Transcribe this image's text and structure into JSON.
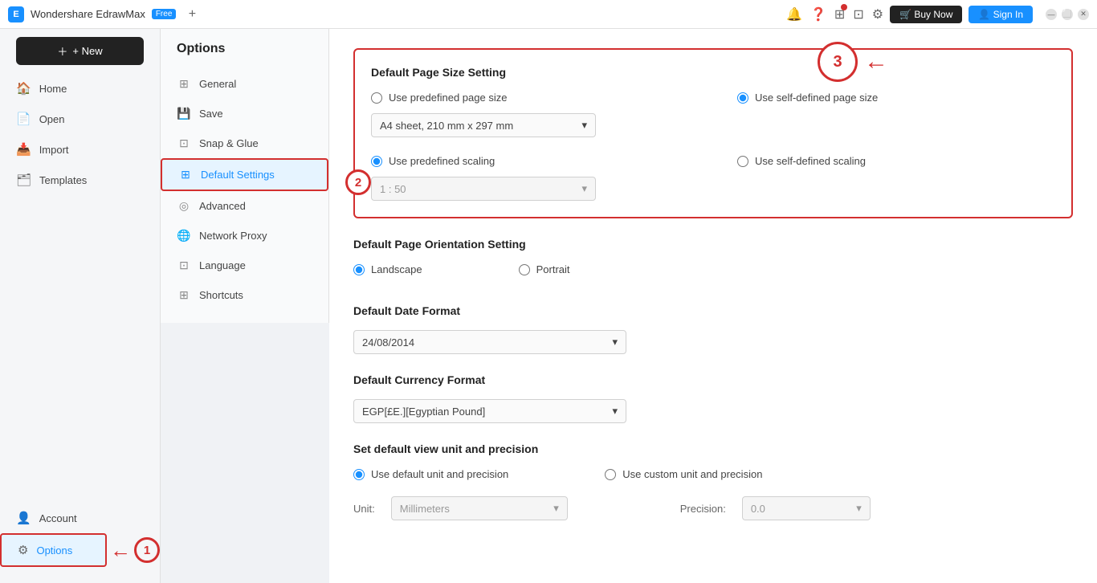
{
  "titleBar": {
    "appName": "Wondershare EdrawMax",
    "freeBadge": "Free",
    "addTab": "+",
    "buyLabel": "🛒 Buy Now",
    "signinLabel": "👤 Sign In"
  },
  "sidebar": {
    "newLabel": "+ New",
    "items": [
      {
        "id": "home",
        "label": "Home",
        "icon": "🏠"
      },
      {
        "id": "open",
        "label": "Open",
        "icon": "📄"
      },
      {
        "id": "import",
        "label": "Import",
        "icon": "📥"
      },
      {
        "id": "templates",
        "label": "Templates",
        "icon": "🗂"
      }
    ],
    "bottomItems": [
      {
        "id": "account",
        "label": "Account",
        "icon": "👤"
      },
      {
        "id": "options",
        "label": "Options",
        "icon": "⚙"
      }
    ]
  },
  "optionsPanel": {
    "title": "Options",
    "items": [
      {
        "id": "general",
        "label": "General",
        "icon": "⊞"
      },
      {
        "id": "save",
        "label": "Save",
        "icon": "💾"
      },
      {
        "id": "snapglue",
        "label": "Snap & Glue",
        "icon": "⊡"
      },
      {
        "id": "defaultsettings",
        "label": "Default Settings",
        "icon": "⊞",
        "active": true
      },
      {
        "id": "advanced",
        "label": "Advanced",
        "icon": "◎"
      },
      {
        "id": "networkproxy",
        "label": "Network Proxy",
        "icon": "🌐"
      },
      {
        "id": "language",
        "label": "Language",
        "icon": "⊡"
      },
      {
        "id": "shortcuts",
        "label": "Shortcuts",
        "icon": "⊞"
      }
    ]
  },
  "content": {
    "pageSizeSection": {
      "title": "Default Page Size Setting",
      "radio1Label": "Use predefined page size",
      "radio2Label": "Use self-defined page size",
      "radio2Checked": true,
      "dropdownValue": "A4 sheet, 210 mm x 297 mm",
      "scalingRadio1Label": "Use predefined scaling",
      "scalingRadio1Checked": true,
      "scalingRadio2Label": "Use self-defined scaling",
      "scalingDropdownValue": "1 : 50"
    },
    "orientationSection": {
      "title": "Default Page Orientation Setting",
      "landscapeLabel": "Landscape",
      "landscapeChecked": true,
      "portraitLabel": "Portrait"
    },
    "dateFormatSection": {
      "title": "Default Date Format",
      "dropdownValue": "24/08/2014"
    },
    "currencySection": {
      "title": "Default Currency Format",
      "dropdownValue": "EGP[£E.][Egyptian Pound]"
    },
    "unitSection": {
      "title": "Set default view unit and precision",
      "radio1Label": "Use default unit and precision",
      "radio1Checked": true,
      "radio2Label": "Use custom unit and precision",
      "unitLabel": "Unit:",
      "unitValue": "Millimeters",
      "precisionLabel": "Precision:",
      "precisionValue": "0.0"
    }
  },
  "annotations": {
    "circle1": "1",
    "circle2": "2",
    "circle3": "3"
  }
}
